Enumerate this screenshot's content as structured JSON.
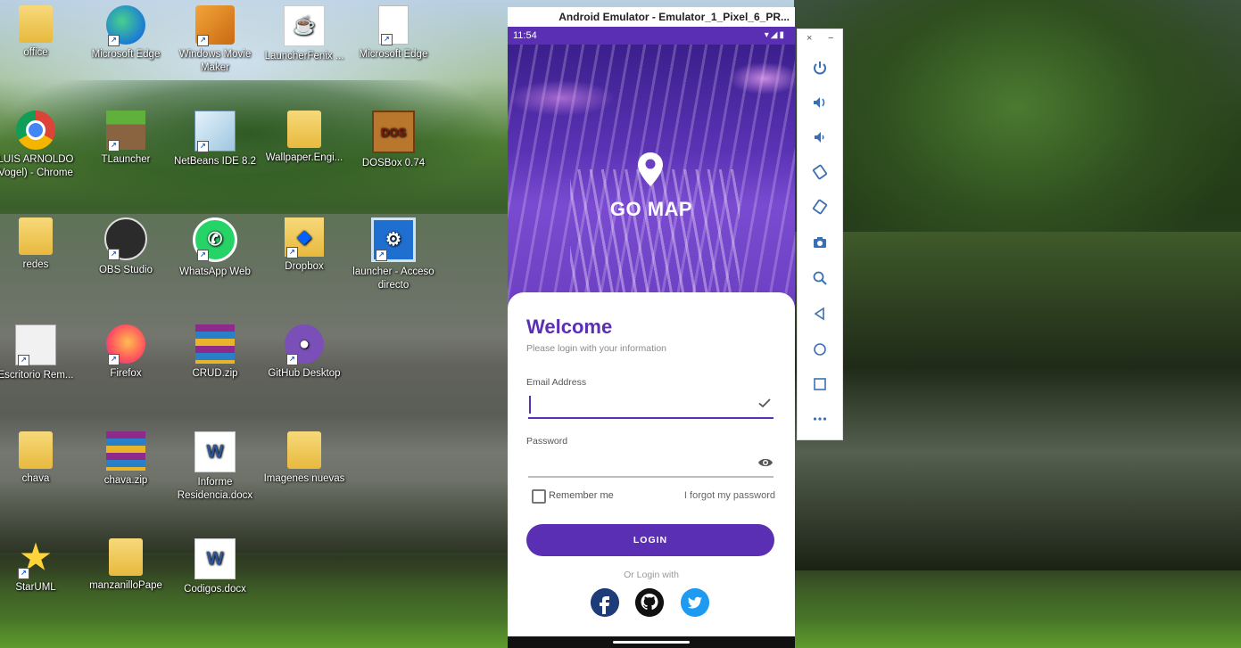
{
  "desktop": {
    "icons": [
      {
        "label": "office",
        "icon": "folder-icon"
      },
      {
        "label": "Microsoft Edge",
        "icon": "edge-icon"
      },
      {
        "label": "Windows Movie Maker",
        "icon": "movie-maker-icon"
      },
      {
        "label": "LauncherFenix ...",
        "icon": "java-icon"
      },
      {
        "label": "Microsoft Edge",
        "icon": "document-icon"
      },
      {
        "label": "LUIS ARNOLDO Vogel) - Chrome",
        "icon": "chrome-icon"
      },
      {
        "label": "TLauncher",
        "icon": "grass-block-icon"
      },
      {
        "label": "NetBeans IDE 8.2",
        "icon": "netbeans-icon"
      },
      {
        "label": "Wallpaper.Engi...",
        "icon": "folder-icon"
      },
      {
        "label": "DOSBox 0.74",
        "icon": "dosbox-icon"
      },
      {
        "label": "redes",
        "icon": "folder-icon"
      },
      {
        "label": "OBS Studio",
        "icon": "obs-icon"
      },
      {
        "label": "WhatsApp Web",
        "icon": "whatsapp-icon"
      },
      {
        "label": "Dropbox",
        "icon": "dropbox-icon"
      },
      {
        "label": "launcher - Acceso directo",
        "icon": "launcher-icon"
      },
      {
        "label": "Escritorio Rem...",
        "icon": "remote-desktop-icon"
      },
      {
        "label": "Firefox",
        "icon": "firefox-icon"
      },
      {
        "label": "CRUD.zip",
        "icon": "winrar-icon"
      },
      {
        "label": "GitHub Desktop",
        "icon": "github-icon"
      },
      {
        "label": "chava",
        "icon": "folder-icon"
      },
      {
        "label": "chava.zip",
        "icon": "winrar-icon"
      },
      {
        "label": "Informe Residencia.docx",
        "icon": "word-icon"
      },
      {
        "label": "Imagenes nuevas",
        "icon": "folder-icon"
      },
      {
        "label": "StarUML",
        "icon": "staruml-icon"
      },
      {
        "label": "manzanilloPape",
        "icon": "folder-icon"
      },
      {
        "label": "Codigos.docx",
        "icon": "word-icon"
      }
    ]
  },
  "emulator": {
    "title": "Android Emulator - Emulator_1_Pixel_6_PR...",
    "status_time": "11:54",
    "status_icons": "▾◢▮",
    "toolbar": {
      "close": "×",
      "minimize": "−",
      "buttons": [
        "power-icon",
        "volume-up-icon",
        "volume-down-icon",
        "rotate-left-icon",
        "rotate-right-icon",
        "camera-icon",
        "zoom-icon",
        "back-icon",
        "home-icon",
        "overview-icon",
        "more-icon"
      ]
    }
  },
  "app": {
    "brand": "GO MAP",
    "welcome": "Welcome",
    "subtitle": "Please login with your information",
    "email_label": "Email Address",
    "email_value": "",
    "password_label": "Password",
    "password_value": "",
    "remember_label": "Remember me",
    "remember_checked": false,
    "forgot_label": "I forgot my password",
    "login_label": "LOGIN",
    "or_login": "Or Login with",
    "social": [
      "facebook-icon",
      "github-icon",
      "twitter-icon"
    ],
    "accent": "#5b2fb3"
  }
}
